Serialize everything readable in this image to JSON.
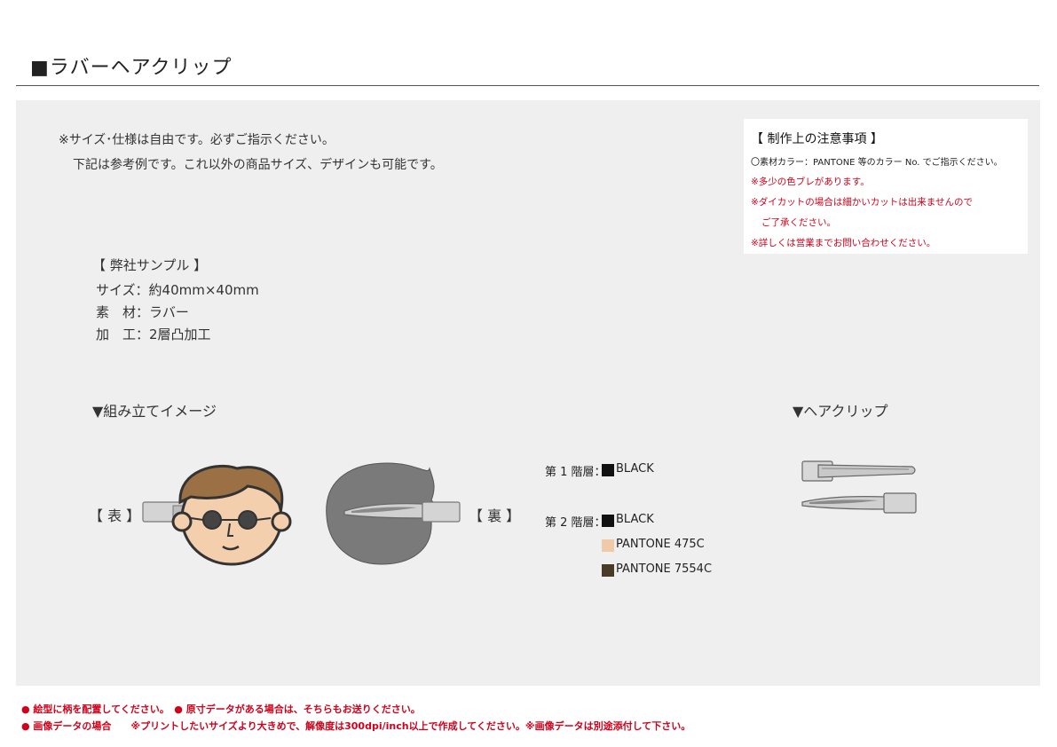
{
  "title": "■ラバーヘアクリップ",
  "intro": {
    "line1": "※サイズ･仕様は自由です。必ずご指示ください。",
    "line2": "下記は参考例です。これ以外の商品サイズ、デザインも可能です。"
  },
  "notes": {
    "title": "【 制作上の注意事項 】",
    "items": [
      "〇素材カラー：PANTONE 等のカラー No. でご指示ください。",
      "※多少の色ブレがあります。",
      "※ダイカットの場合は細かいカットは出来ませんので",
      "ご了承ください。",
      "※詳しくは営業までお問い合わせください。"
    ]
  },
  "sample": {
    "heading": "【 弊社サンプル 】",
    "size": "サイズ：約40mm×40mm",
    "material": "素　材：ラバー",
    "process": "加　工：2層凸加工"
  },
  "assembly": {
    "heading": "▼組み立てイメージ",
    "front_label": "【 表 】",
    "back_label": "【 裏 】"
  },
  "layers": {
    "layer1_label": "第 1 階層：",
    "layer1_color": "BLACK",
    "layer2_label": "第 2 階層：",
    "layer2_colors": [
      "BLACK",
      "PANTONE 475C",
      "PANTONE 7554C"
    ]
  },
  "clip": {
    "heading": "▼ヘアクリップ"
  },
  "footer": {
    "line1": "● 絵型に柄を配置してください。　● 原寸データがある場合は、そちらもお送りください。",
    "line2": "● 画像データの場合　　※プリントしたいサイズより大きめで、解像度は300dpi/inch以上で作成してください。※画像データは別途添付して下さい。"
  },
  "colors": {
    "hair": "#9a7044",
    "skin": "#f3cfae",
    "back_gray": "#7a7a7a",
    "alert_red": "#d0021b",
    "panel_bg": "#efefef"
  }
}
